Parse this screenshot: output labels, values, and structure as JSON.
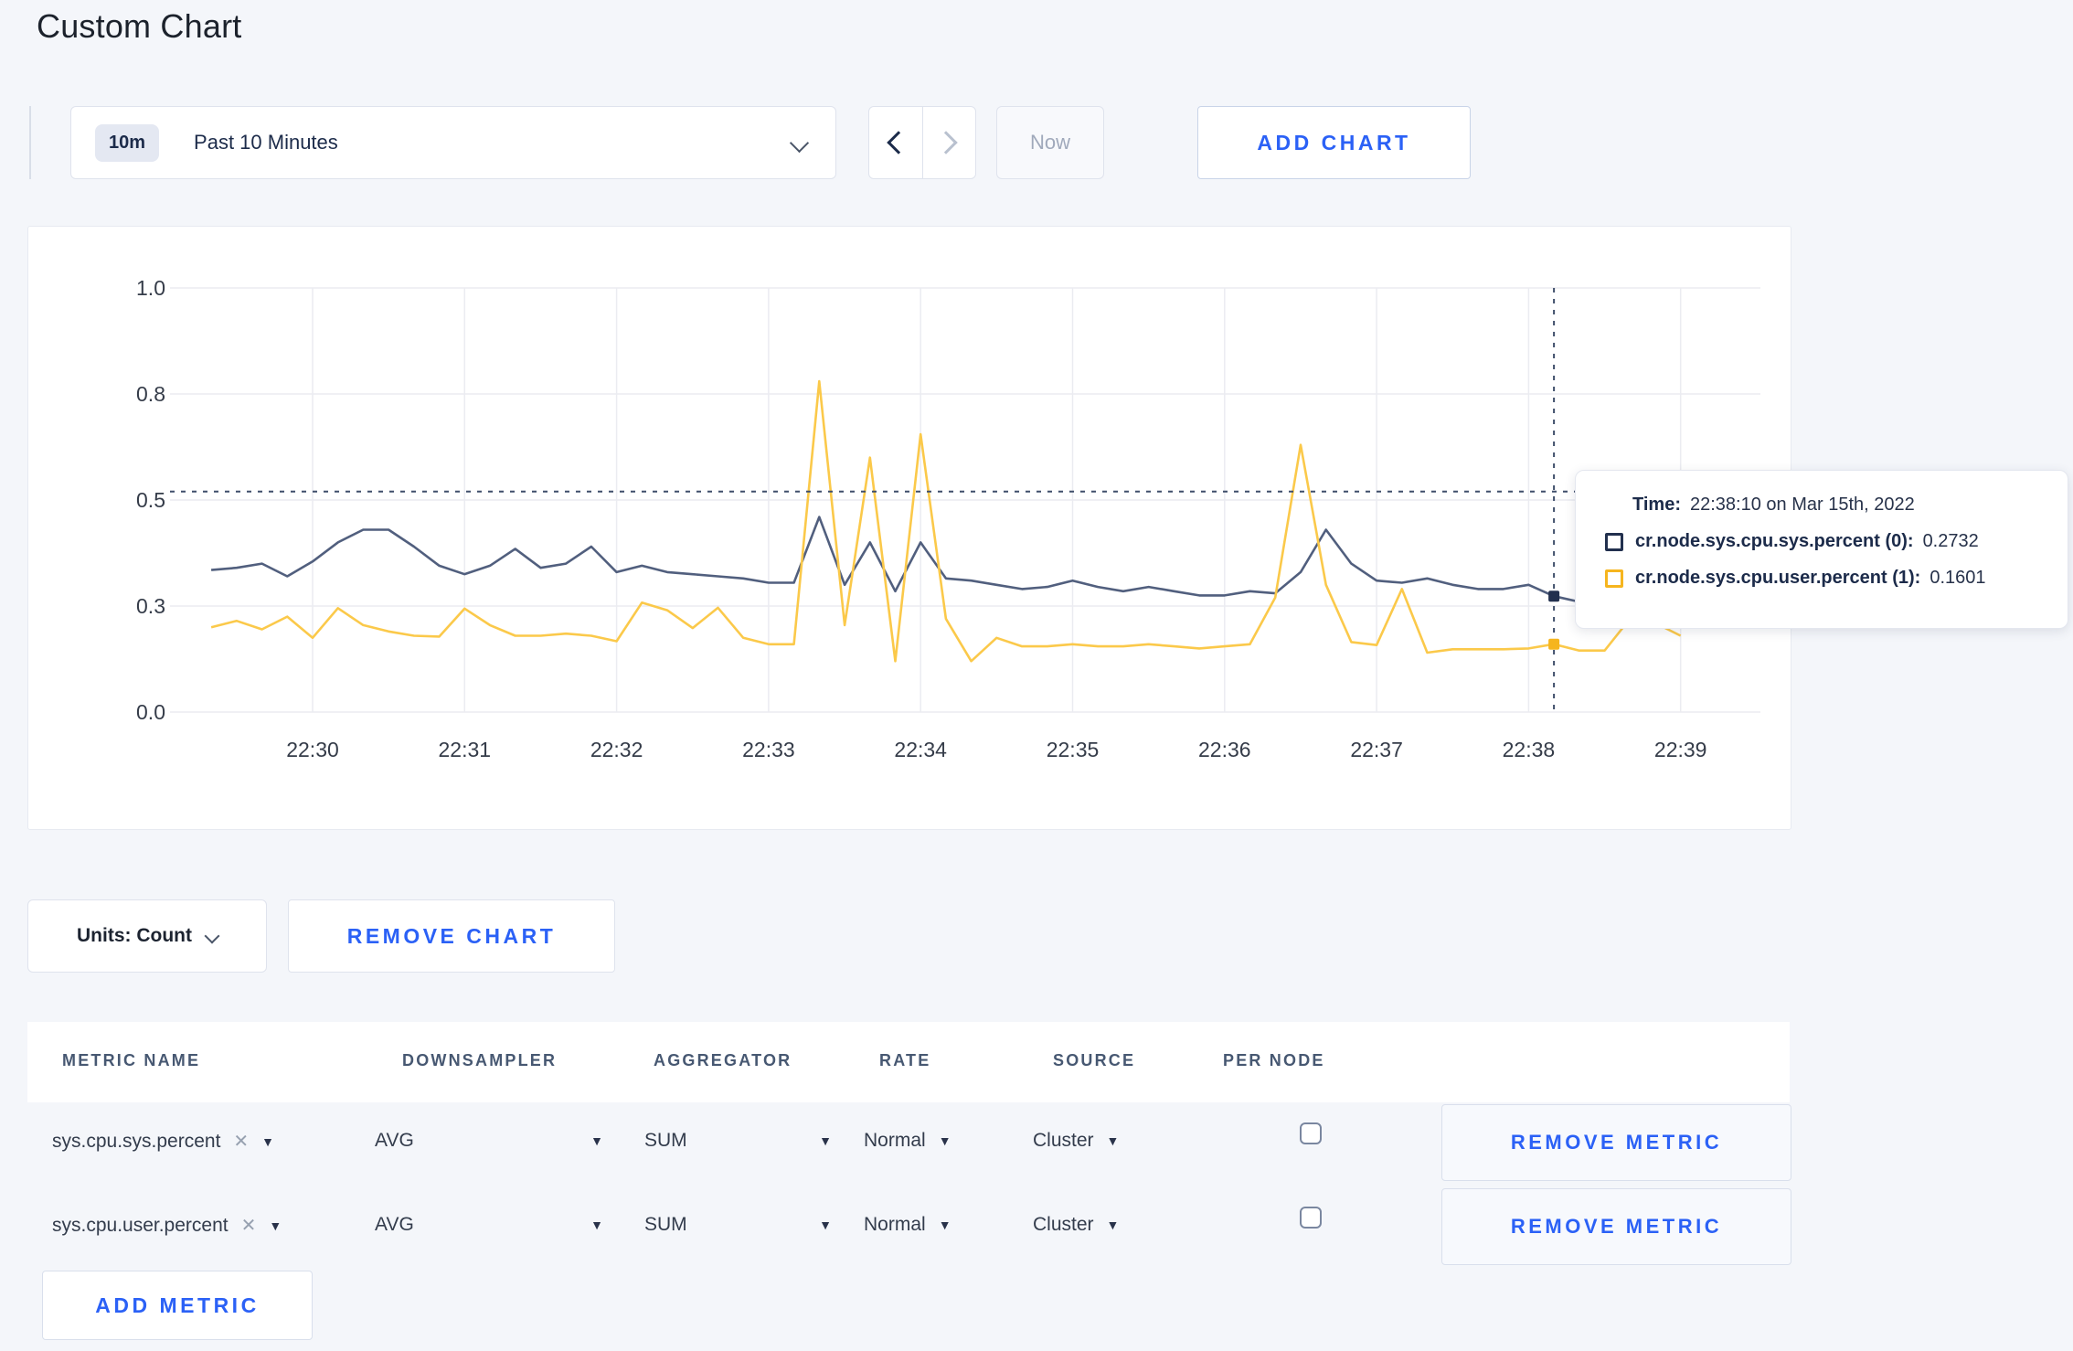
{
  "page": {
    "title": "Custom Chart"
  },
  "toolbar": {
    "time_badge": "10m",
    "time_range_label": "Past 10 Minutes",
    "now_label": "Now",
    "add_chart_label": "ADD CHART"
  },
  "colors": {
    "accent_blue": "#2b61f6",
    "page_background": "#f4f6fa",
    "grid_line": "#ebecf1",
    "crosshair": "#3f4e6a",
    "series_sys_line": "#515f7e",
    "series_sys_swatch": "#22304e",
    "series_user_line": "#fbc94a",
    "series_user_swatch": "#f6b51e"
  },
  "chart_data": {
    "type": "line",
    "title": "",
    "xlabel": "",
    "ylabel": "",
    "grid": true,
    "legend_position": "tooltip",
    "x_axis": {
      "labels": [
        "22:30",
        "22:31",
        "22:32",
        "22:33",
        "22:34",
        "22:35",
        "22:36",
        "22:37",
        "22:38",
        "22:39"
      ],
      "minutes": 10
    },
    "y_axis": {
      "tick_labels": [
        "0.0",
        "0.3",
        "0.5",
        "0.8",
        "1.0"
      ],
      "tick_values": [
        0,
        0.25,
        0.5,
        0.75,
        1.0
      ],
      "ylim": [
        0,
        1
      ]
    },
    "series": [
      {
        "name": "cr.node.sys.cpu.sys.percent (0)",
        "color": "#515f7e",
        "swatch_color": "#22304e",
        "start_time": "22:29:20",
        "start_offset_seconds": -40,
        "interval_seconds": 10,
        "values": [
          0.335,
          0.34,
          0.35,
          0.32,
          0.355,
          0.4,
          0.43,
          0.43,
          0.39,
          0.345,
          0.325,
          0.345,
          0.385,
          0.34,
          0.35,
          0.39,
          0.33,
          0.345,
          0.33,
          0.325,
          0.32,
          0.315,
          0.305,
          0.305,
          0.46,
          0.3,
          0.4,
          0.285,
          0.4,
          0.315,
          0.31,
          0.3,
          0.29,
          0.295,
          0.31,
          0.295,
          0.285,
          0.295,
          0.285,
          0.275,
          0.275,
          0.285,
          0.28,
          0.33,
          0.43,
          0.35,
          0.31,
          0.305,
          0.315,
          0.3,
          0.29,
          0.29,
          0.3,
          0.2732,
          0.26
        ]
      },
      {
        "name": "cr.node.sys.cpu.user.percent (1)",
        "color": "#fbc94a",
        "swatch_color": "#f6b51e",
        "start_time": "22:29:20",
        "start_offset_seconds": -40,
        "interval_seconds": 10,
        "values": [
          0.2,
          0.215,
          0.195,
          0.225,
          0.175,
          0.245,
          0.205,
          0.19,
          0.18,
          0.178,
          0.244,
          0.205,
          0.18,
          0.18,
          0.185,
          0.18,
          0.167,
          0.258,
          0.24,
          0.198,
          0.246,
          0.175,
          0.16,
          0.16,
          0.78,
          0.205,
          0.6,
          0.12,
          0.655,
          0.22,
          0.12,
          0.175,
          0.155,
          0.155,
          0.16,
          0.155,
          0.155,
          0.16,
          0.155,
          0.15,
          0.155,
          0.16,
          0.27,
          0.63,
          0.3,
          0.165,
          0.158,
          0.29,
          0.14,
          0.148,
          0.148,
          0.148,
          0.15,
          0.1601,
          0.145,
          0.145,
          0.22,
          0.21,
          0.18
        ]
      }
    ],
    "crosshair": {
      "time": "22:38:10",
      "offset_seconds": 490,
      "hline_value": 0.52,
      "points": [
        {
          "series_index": 0,
          "value": 0.2732
        },
        {
          "series_index": 1,
          "value": 0.1601
        }
      ]
    }
  },
  "tooltip": {
    "time_label": "Time:",
    "time_value": "22:38:10 on Mar 15th, 2022",
    "entries": [
      {
        "name": "cr.node.sys.cpu.sys.percent (0):",
        "value": "0.2732",
        "swatch_color": "#22304e"
      },
      {
        "name": "cr.node.sys.cpu.user.percent (1):",
        "value": "0.1601",
        "swatch_color": "#f6b51e"
      }
    ]
  },
  "chart_footer": {
    "units_label": "Units: Count",
    "remove_chart_label": "REMOVE CHART"
  },
  "metrics_table": {
    "columns": [
      "METRIC NAME",
      "DOWNSAMPLER",
      "AGGREGATOR",
      "RATE",
      "SOURCE",
      "PER NODE"
    ],
    "rows": [
      {
        "metric_name": "sys.cpu.sys.percent",
        "downsampler": "AVG",
        "aggregator": "SUM",
        "rate": "Normal",
        "source": "Cluster",
        "per_node": false,
        "remove_label": "REMOVE METRIC"
      },
      {
        "metric_name": "sys.cpu.user.percent",
        "downsampler": "AVG",
        "aggregator": "SUM",
        "rate": "Normal",
        "source": "Cluster",
        "per_node": false,
        "remove_label": "REMOVE METRIC"
      }
    ],
    "add_metric_label": "ADD METRIC"
  }
}
